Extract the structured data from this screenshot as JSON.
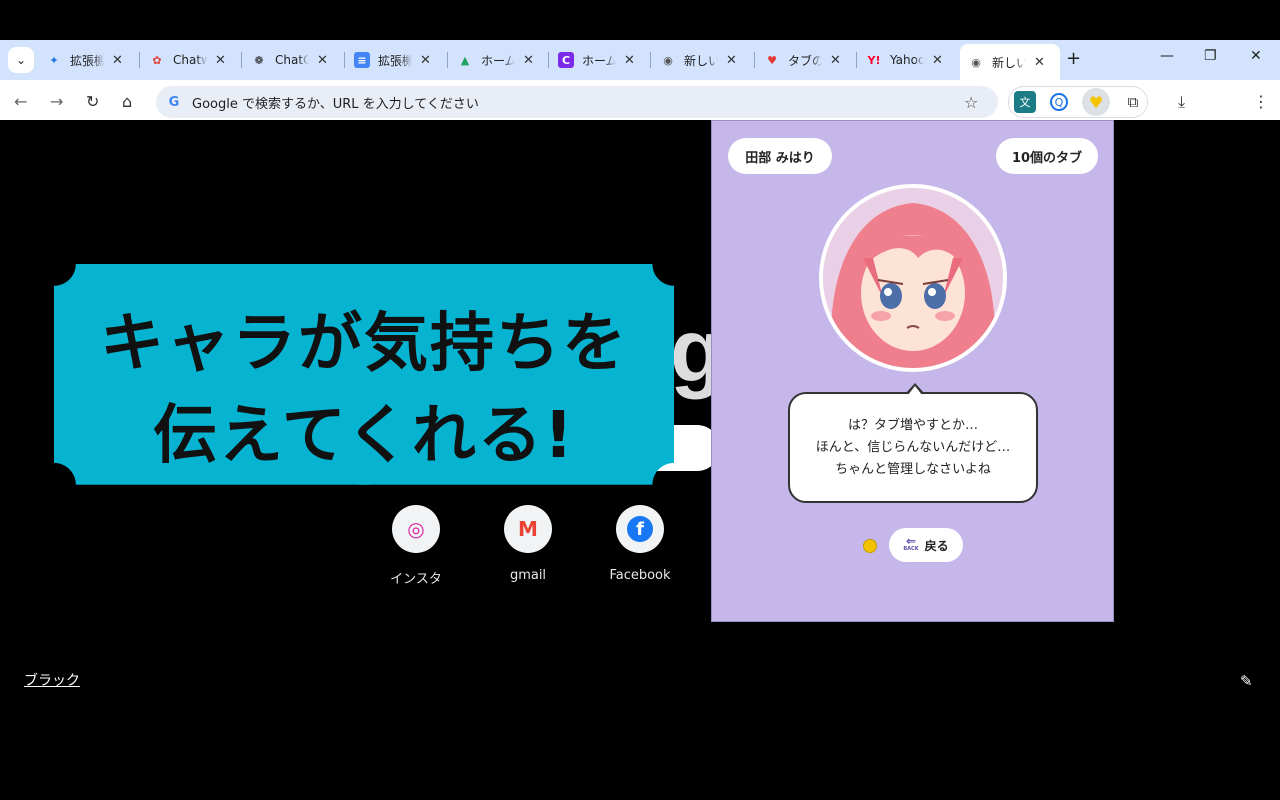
{
  "browser": {
    "tabs": [
      {
        "icon": "puzzle-icon",
        "title": "拡張機能",
        "fav": "✦",
        "color": "#1a73e8",
        "bg": "transparent"
      },
      {
        "icon": "chatwork-icon",
        "title": "Chatwork",
        "fav": "✿",
        "color": "#e0403a",
        "bg": "transparent"
      },
      {
        "icon": "chatgpt-icon",
        "title": "ChatGPT",
        "fav": "❁",
        "color": "#222",
        "bg": "transparent"
      },
      {
        "icon": "docs-icon",
        "title": "拡張機能",
        "fav": "≡",
        "color": "#fff",
        "bg": "#4285f4"
      },
      {
        "icon": "drive-icon",
        "title": "ホーム",
        "fav": "▲",
        "color": "#1ea362",
        "bg": "transparent"
      },
      {
        "icon": "canva-icon",
        "title": "ホーム",
        "fav": "C",
        "color": "#fff",
        "bg": "#7d2ae8"
      },
      {
        "icon": "chrome-icon",
        "title": "新しいタブ",
        "fav": "◉",
        "color": "#555",
        "bg": "transparent"
      },
      {
        "icon": "tab-extension-icon",
        "title": "タブの気持ち",
        "fav": "♥",
        "color": "#e53935",
        "bg": "transparent"
      },
      {
        "icon": "yahoo-icon",
        "title": "Yahoo!",
        "fav": "Y!",
        "color": "#ff0033",
        "bg": "transparent"
      },
      {
        "icon": "chrome-icon",
        "title": "新しいタブ",
        "fav": "◉",
        "color": "#555",
        "bg": "transparent"
      }
    ],
    "close_glyph": "✕",
    "new_tab_glyph": "+",
    "window": {
      "minimize": "—",
      "restore": "❐",
      "close": "✕"
    },
    "address_placeholder": "Google で検索するか、URL を入力してください",
    "google_g": "G",
    "nav": {
      "back": "←",
      "forward": "→",
      "reload": "↻",
      "home": "⌂"
    },
    "bookmark_glyph": "☆",
    "download_glyph": "⤓",
    "menu_glyph": "⋮"
  },
  "page": {
    "logo_partial": "g",
    "shortcuts": [
      {
        "label": "インスタ",
        "glyph": "◎",
        "color": "#d6249f"
      },
      {
        "label": "gmail",
        "glyph": "M",
        "color": "#ea4335"
      },
      {
        "label": "Facebook",
        "glyph": "f",
        "color": "#1877f2"
      }
    ],
    "theme_link": "ブラック",
    "edit_glyph": "✎"
  },
  "banner": {
    "line1": "キャラが気持ちを",
    "line2": "伝えてくれる!"
  },
  "popup": {
    "character_name": "田部 みはり",
    "tab_count": "10個のタブ",
    "speech": [
      "は？タブ増やすとか…",
      "ほんと、信じらんないんだけど…",
      "ちゃんと管理しなさいよね"
    ],
    "back_label": "戻る",
    "back_icon_text": "BACK"
  }
}
